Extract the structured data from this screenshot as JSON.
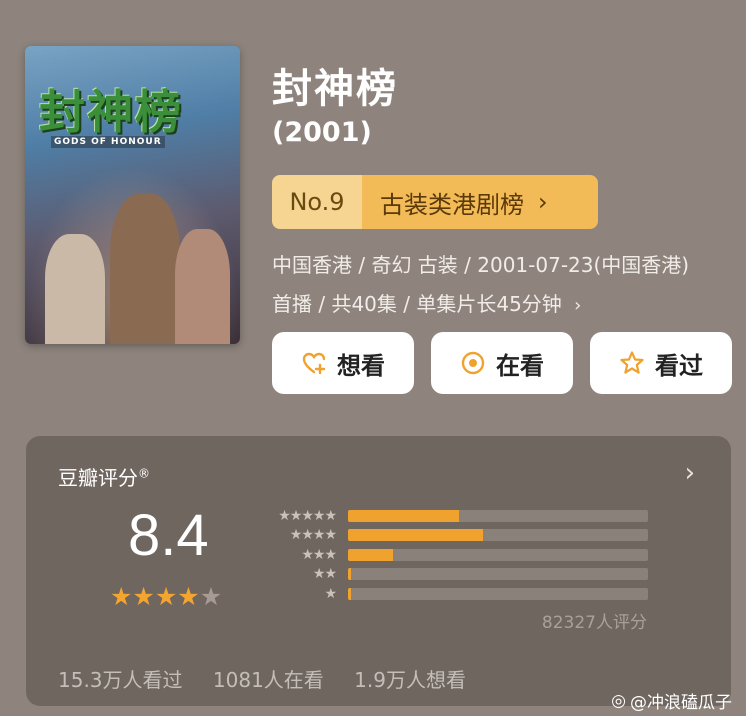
{
  "poster": {
    "title": "封神榜",
    "subtitle": "GODS OF HONOUR"
  },
  "header": {
    "title": "封神榜",
    "year": "(2001)"
  },
  "rank": {
    "number": "No.9",
    "name": "古装类港剧榜",
    "chev": "›"
  },
  "meta": {
    "line1": "中国香港 / 奇幻 古装 / 2001-07-23(中国香港)",
    "line2": "首播 / 共40集 / 单集片长45分钟",
    "chev": "›"
  },
  "buttons": {
    "want": "想看",
    "doing": "在看",
    "done": "看过"
  },
  "rating": {
    "label": "豆瓣评分",
    "mark": "®",
    "score": "8.4",
    "stars_filled": 4,
    "stars_total": 5,
    "chev": "›",
    "distribution": [
      {
        "stars": "★★★★★",
        "fraction": 0.37
      },
      {
        "stars": "★★★★",
        "fraction": 0.45
      },
      {
        "stars": "★★★",
        "fraction": 0.15
      },
      {
        "stars": "★★",
        "fraction": 0.01
      },
      {
        "stars": "★",
        "fraction": 0.01
      }
    ],
    "count": "82327人评分"
  },
  "stats": {
    "watched": "15.3万人看过",
    "watching": "1081人在看",
    "wish": "1.9万人想看"
  },
  "watermark": "@冲浪磕瓜子",
  "colors": {
    "accent": "#f0a22e",
    "background": "#8e847d",
    "card": "#6f6660"
  }
}
